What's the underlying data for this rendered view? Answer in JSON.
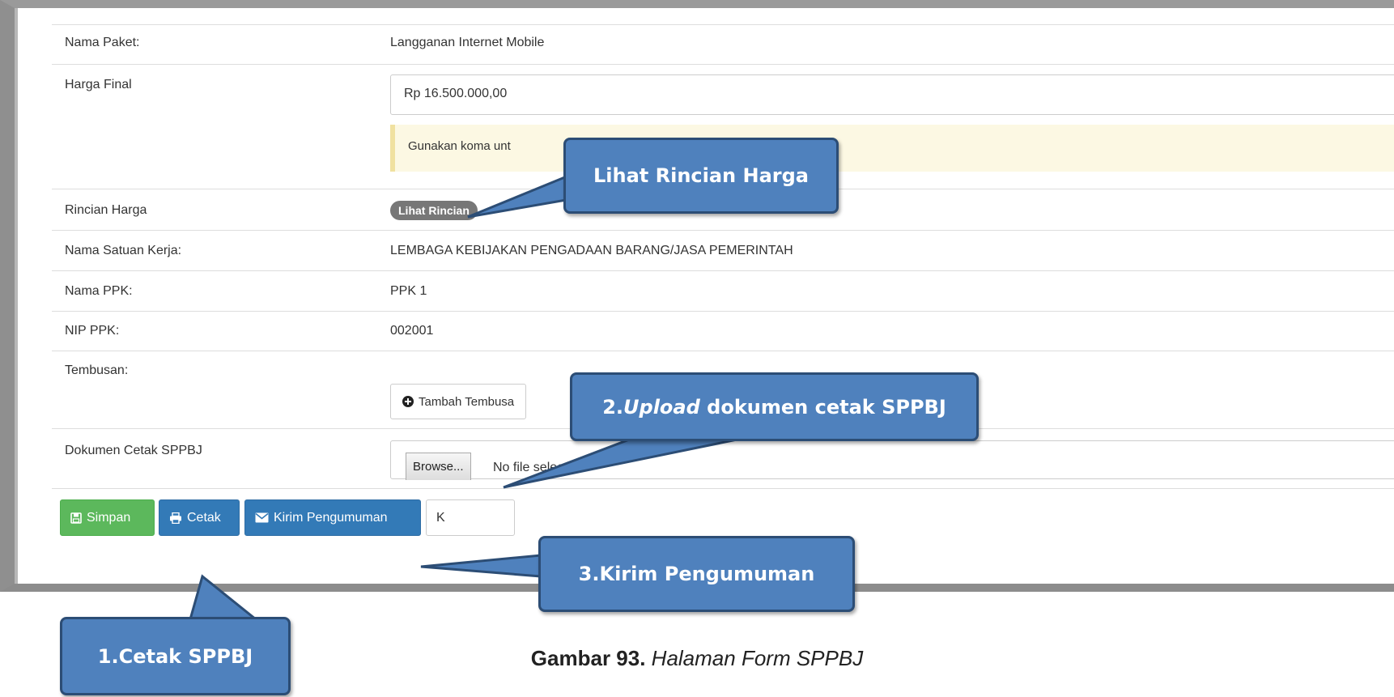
{
  "form": {
    "nama_paket_label": "Nama Paket:",
    "nama_paket_value": "Langganan Internet Mobile",
    "harga_final_label": "Harga Final",
    "harga_final_value": "Rp 16.500.000,00",
    "harga_hint": "Gunakan koma unt",
    "rincian_label": "Rincian Harga",
    "rincian_badge": "Lihat Rincian",
    "satker_label": "Nama Satuan Kerja:",
    "satker_value": "LEMBAGA KEBIJAKAN PENGADAAN BARANG/JASA PEMERINTAH",
    "ppk_label": "Nama PPK:",
    "ppk_value": "PPK 1",
    "nip_label": "NIP PPK:",
    "nip_value": "002001",
    "tembusan_label": "Tembusan:",
    "tembusan_button": "Tambah Tembusa",
    "dokumen_label": "Dokumen Cetak SPPBJ",
    "browse_label": "Browse...",
    "no_file_text": "No file selected."
  },
  "actions": {
    "simpan": "Simpan",
    "cetak": "Cetak",
    "kirim": "Kirim Pengumuman",
    "kembali_partial": "K"
  },
  "callouts": {
    "lihat_rincian": "Lihat Rincian Harga",
    "upload_prefix": "2.",
    "upload_italic": "Upload",
    "upload_rest": " dokumen cetak SPPBJ",
    "kirim": "3.Kirim Pengumuman",
    "cetak": "1.Cetak SPPBJ"
  },
  "caption": {
    "number": "Gambar 93.",
    "text": "Halaman Form SPPBJ"
  },
  "icons": [
    "save-icon",
    "print-icon",
    "envelope-icon",
    "plus-circle-icon"
  ],
  "colors": {
    "success": "#5cb85c",
    "primary": "#337ab7",
    "callout": "#4f81bd",
    "alert_bg": "#fcf8e3",
    "badge": "#777777"
  }
}
